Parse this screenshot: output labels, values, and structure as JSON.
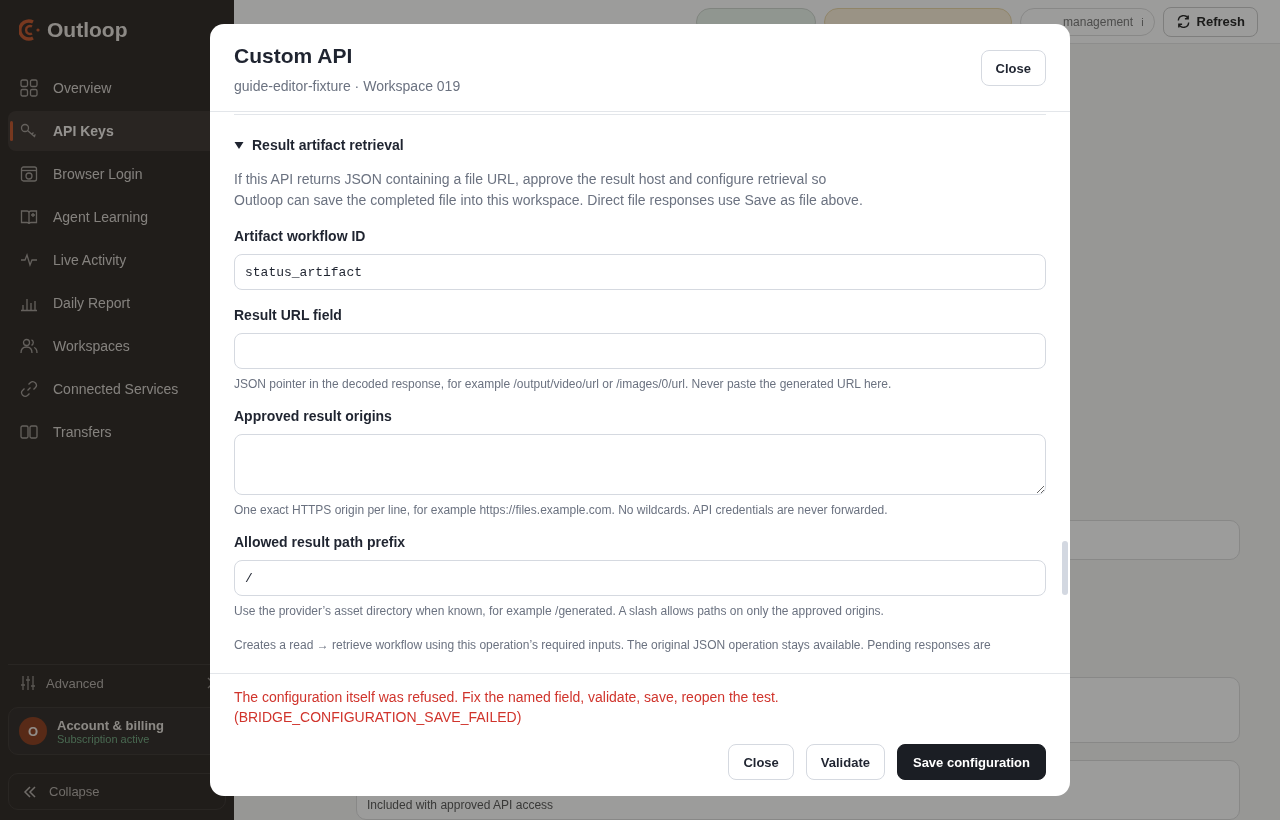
{
  "brand": {
    "name": "Outloop"
  },
  "nav": [
    {
      "label": "Overview",
      "selected": false
    },
    {
      "label": "API Keys",
      "selected": true
    },
    {
      "label": "Browser Login",
      "selected": false
    },
    {
      "label": "Agent Learning",
      "selected": false
    },
    {
      "label": "Live Activity",
      "selected": false
    },
    {
      "label": "Daily Report",
      "selected": false
    },
    {
      "label": "Workspaces",
      "selected": false
    },
    {
      "label": "Connected Services",
      "selected": false
    },
    {
      "label": "Transfers",
      "selected": false
    }
  ],
  "advanced": {
    "label": "Advanced"
  },
  "account": {
    "avatar": "O",
    "name": "Account & billing",
    "status": "Subscription active"
  },
  "collapse": {
    "label": "Collapse"
  },
  "background": {
    "header_buttons": [
      {
        "label": "management",
        "kind": "pill",
        "info": "i"
      },
      {
        "label": "Refresh",
        "kind": "refresh"
      }
    ],
    "footnote": "Included with approved API access"
  },
  "modal": {
    "title": "Custom API",
    "subtitle": "guide-editor-fixture · Workspace 019",
    "close": "Close",
    "section": {
      "title": "Result artifact retrieval",
      "expanded": true,
      "description": "If this API returns JSON containing a file URL, approve the result host and configure retrieval so Outloop can save the completed file into this workspace. Direct file responses use Save as file above."
    },
    "fields": [
      {
        "kind": "input",
        "label": "Artifact workflow ID",
        "value": "status_artifact"
      },
      {
        "kind": "input",
        "label": "Result URL field",
        "help": "JSON pointer in the decoded response, for example /output/video/url or /images/0/url. Never paste the generated URL here."
      },
      {
        "kind": "textarea",
        "label": "Approved result origins",
        "help": "One exact HTTPS origin per line, for example https://files.example.com. No wildcards. API credentials are never forwarded."
      },
      {
        "kind": "input",
        "label": "Allowed result path prefix",
        "value": "/",
        "help": "Use the provider’s asset directory when known, for example /generated. A slash allows paths on only the approved origins."
      }
    ],
    "note": "Creates a read → retrieve workflow using this operation’s required inputs. The original JSON operation stays available. Pending responses are",
    "error": "The configuration itself was refused. Fix the named field, validate, save, reopen the test. (BRIDGE_CONFIGURATION_SAVE_FAILED)",
    "buttons": [
      {
        "label": "Close",
        "kind": "secondary"
      },
      {
        "label": "Validate",
        "kind": "secondary"
      },
      {
        "label": "Save configuration",
        "kind": "primary"
      }
    ]
  }
}
